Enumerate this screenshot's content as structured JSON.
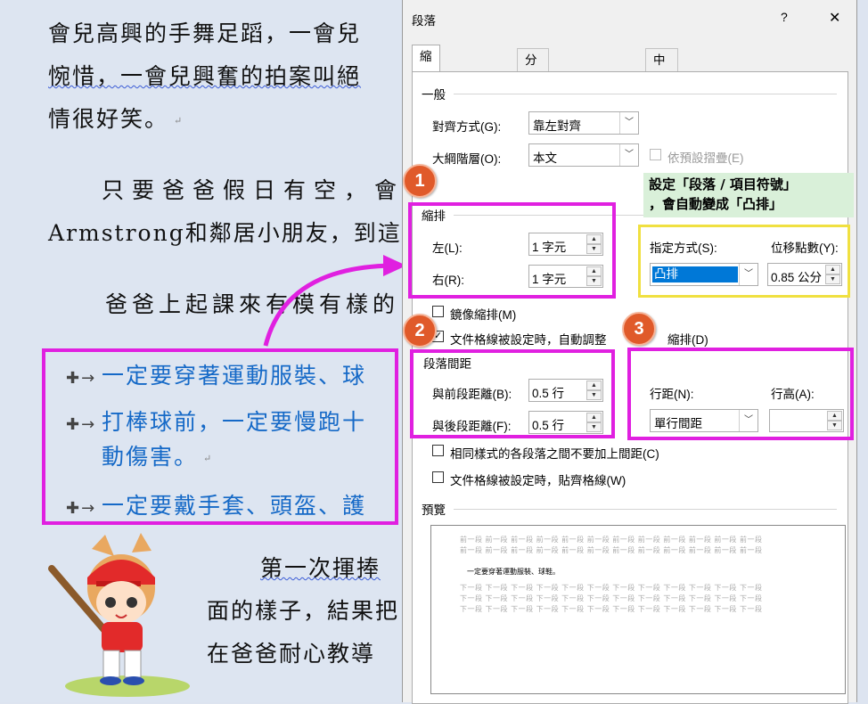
{
  "document": {
    "lines": [
      "會兒高興的手舞足蹈，一會兒",
      "惋惜，一會兒興奮的拍案叫絕",
      "情很好笑。",
      "只要爸爸假日有空，會",
      "Armstrong和鄰居小朋友，到這",
      "爸爸上起課來有模有樣的",
      "第一次揮捧",
      "面的樣子，結果把",
      "在爸爸耐心教導"
    ],
    "bullets": [
      "一定要穿著運動服裝、球",
      "打棒球前，一定要慢跑十",
      "動傷害。",
      "一定要戴手套、頭盔、護"
    ]
  },
  "dialog": {
    "title": "段落",
    "help": "?",
    "close": "✕",
    "tabs": [
      "縮排與行距(I)",
      "分行與分頁設定(P)",
      "中文印刷樣式(H)"
    ],
    "general": {
      "heading": "一般",
      "align_label": "對齊方式(G):",
      "align_value": "靠左對齊",
      "outline_label": "大綱階層(O):",
      "outline_value": "本文",
      "collapse_label": "依預設摺疊(E)"
    },
    "indent": {
      "heading": "縮排",
      "left_label": "左(L):",
      "left_value": "1 字元",
      "right_label": "右(R):",
      "right_value": "1 字元",
      "special_label": "指定方式(S):",
      "special_value": "凸排",
      "by_label": "位移點數(Y):",
      "by_value": "0.85 公分",
      "mirror_label": "鏡像縮排(M)",
      "auto_adjust_label": "文件格線被設定時，自動調整",
      "auto_adjust_tail": "縮排(D)"
    },
    "spacing": {
      "heading": "段落間距",
      "before_label": "與前段距離(B):",
      "before_value": "0.5 行",
      "after_label": "與後段距離(F):",
      "after_value": "0.5 行",
      "line_label": "行距(N):",
      "line_value": "單行間距",
      "at_label": "行高(A):",
      "at_value": "",
      "no_space_label": "相同樣式的各段落之間不要加上間距(C)",
      "snap_label": "文件格線被設定時，貼齊格線(W)"
    },
    "preview": {
      "heading": "預覽",
      "prev_line": "前一段 前一段 前一段 前一段 前一段 前一段 前一段 前一段 前一段 前一段 前一段 前一段",
      "sample": "一定要穿著運動服裝、球鞋。",
      "next_line": "下一段 下一段 下一段 下一段 下一段 下一段 下一段 下一段 下一段 下一段 下一段 下一段"
    }
  },
  "annotations": {
    "badges": [
      "1",
      "2",
      "3"
    ],
    "note": [
      "設定「段落 / 項目符號」",
      "，會自動變成「凸排」"
    ],
    "colors": {
      "magenta": "#e020e0",
      "yellow": "#f0e040",
      "badge": "#e05a2a"
    }
  }
}
